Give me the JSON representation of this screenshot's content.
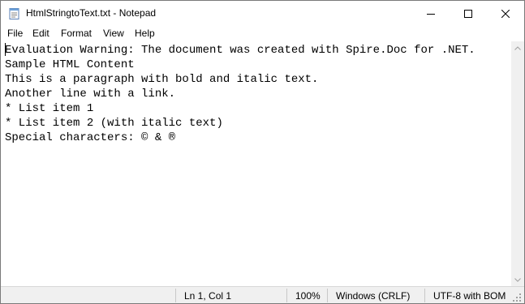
{
  "window": {
    "title": "HtmlStringtoText.txt - Notepad",
    "app_icon": "notepad-icon"
  },
  "menu": [
    "File",
    "Edit",
    "Format",
    "View",
    "Help"
  ],
  "editor": {
    "lines": [
      "Evaluation Warning: The document was created with Spire.Doc for .NET.",
      "Sample HTML Content",
      "This is a paragraph with bold and italic text.",
      "Another line with a link.",
      "* List item 1",
      "* List item 2 (with italic text)",
      "Special characters: © & ®"
    ]
  },
  "status": {
    "position": "Ln 1, Col 1",
    "zoom": "100%",
    "line_ending": "Windows (CRLF)",
    "encoding": "UTF-8 with BOM"
  }
}
